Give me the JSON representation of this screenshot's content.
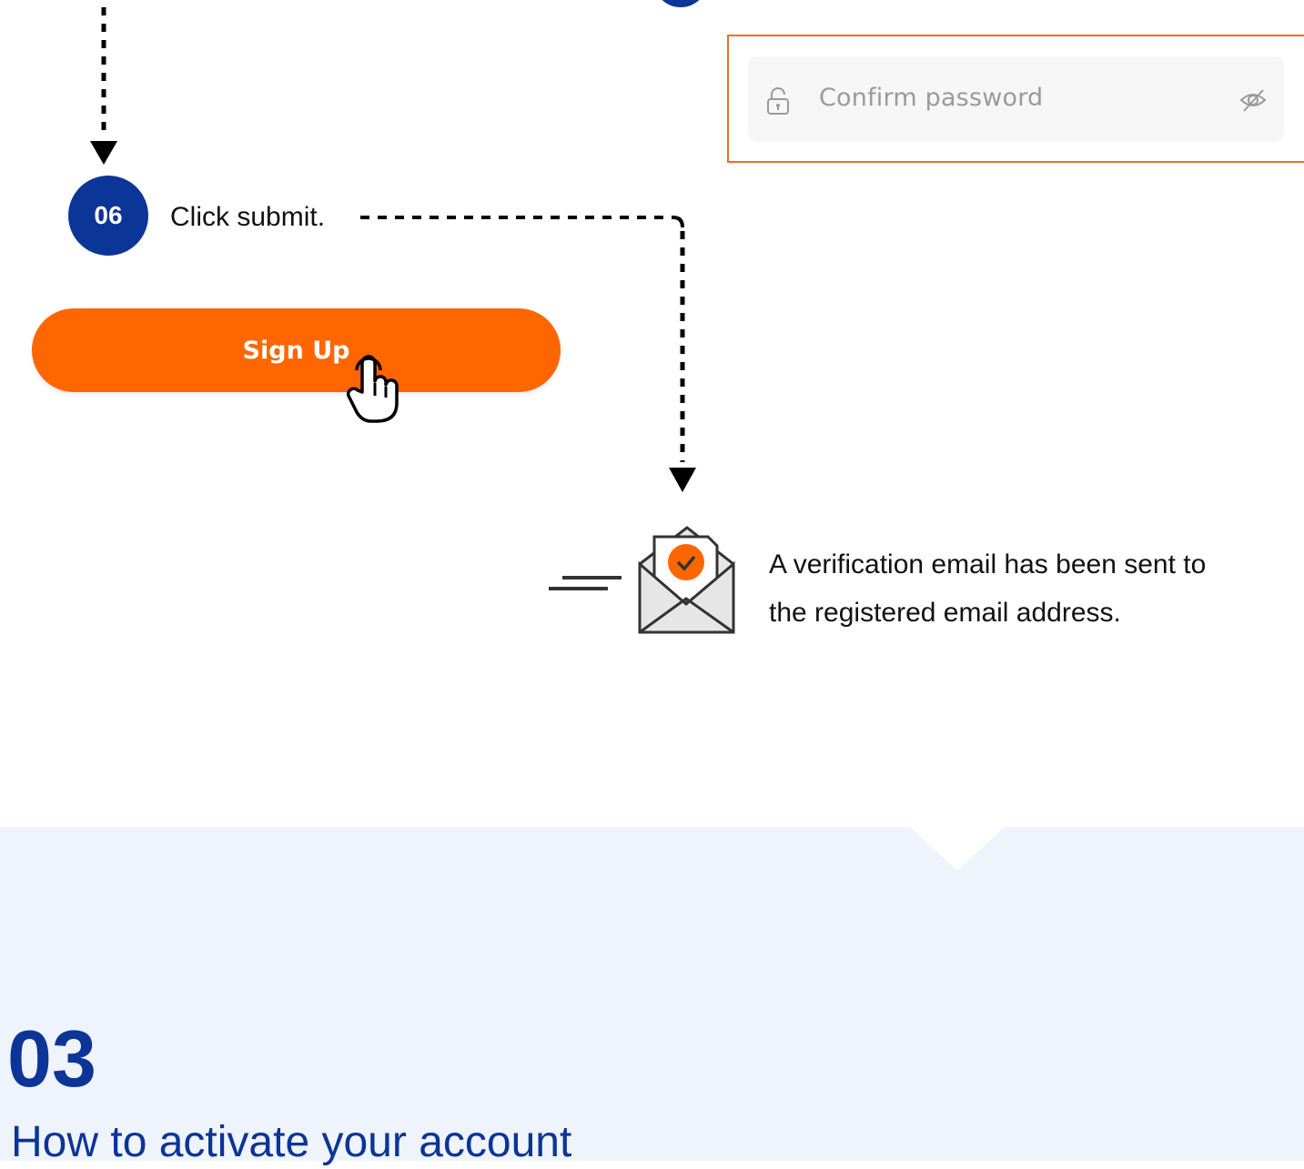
{
  "confirm_password": {
    "placeholder": "Confirm password",
    "lock_icon": "lock-icon",
    "eye_icon": "eye-slash-icon"
  },
  "step": {
    "number": "06",
    "text": "Click submit."
  },
  "signup_button": {
    "label": "Sign Up",
    "cursor_icon": "hand-pointer-icon"
  },
  "verification": {
    "icon": "open-envelope-check-icon",
    "line1": "A verification email has been sent to",
    "line2": "the registered email address."
  },
  "next_section": {
    "number": "03",
    "title": "How to activate your account"
  },
  "colors": {
    "brand_blue": "#0b3596",
    "accent_orange": "#ff6600",
    "highlight_border": "#f26d21",
    "section_bg": "#eff3fb"
  }
}
